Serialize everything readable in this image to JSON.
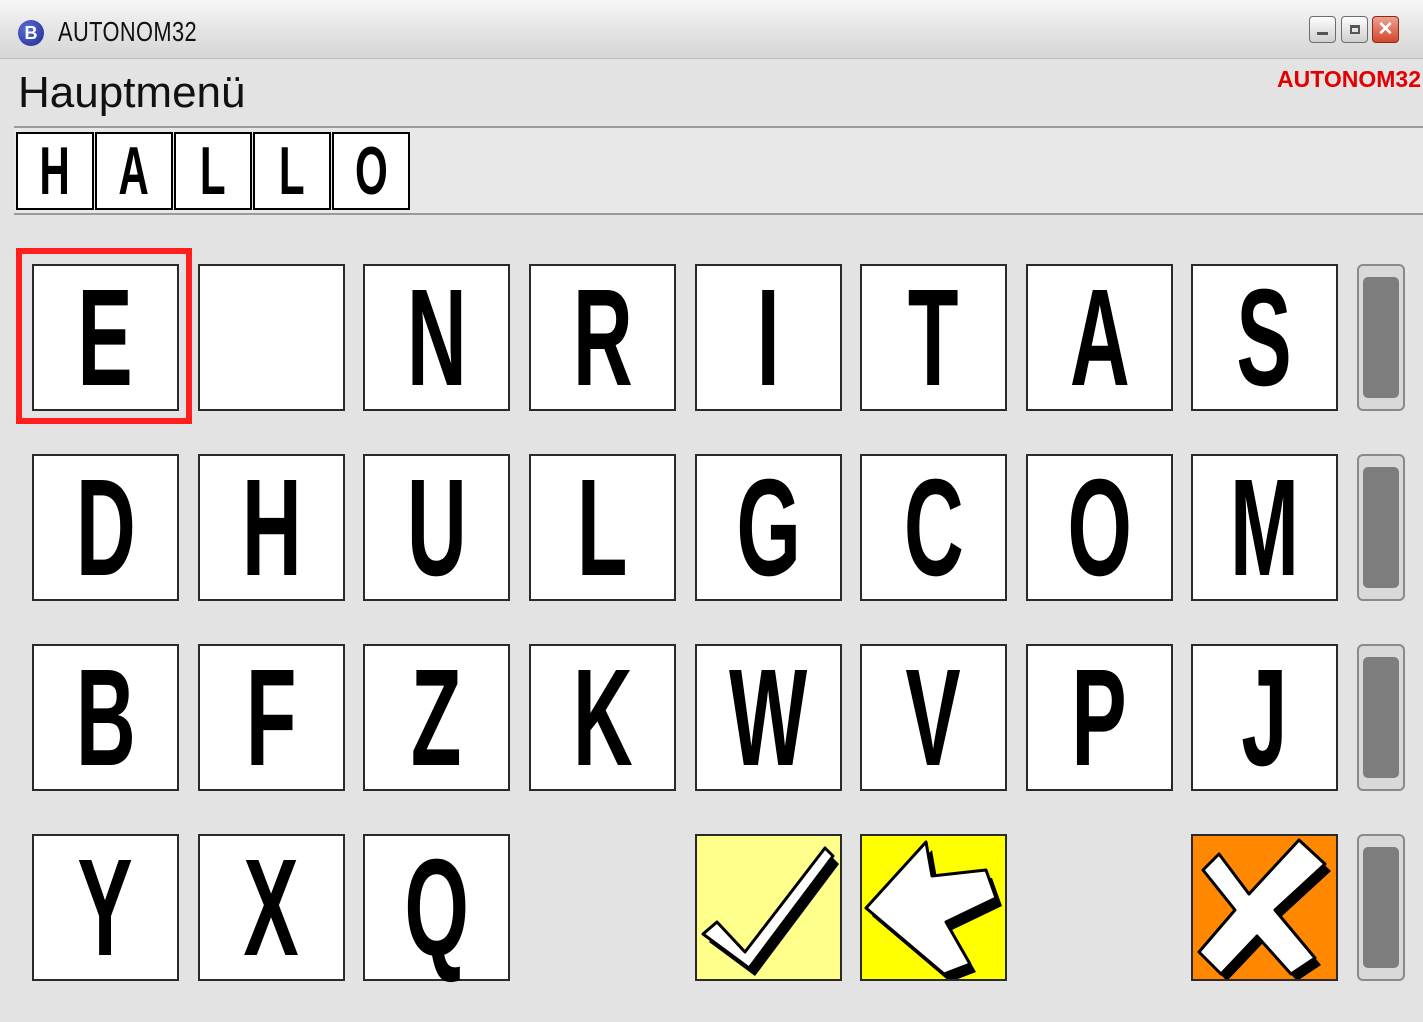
{
  "window": {
    "icon": "B",
    "title": "AUTONOM32",
    "minimize_icon": "minimize-icon",
    "maximize_icon": "maximize-icon",
    "close_icon": "close-icon"
  },
  "header": {
    "title": "Hauptmenü",
    "brand": "AUTONOM32"
  },
  "text_output": {
    "letters": [
      "H",
      "A",
      "L",
      "L",
      "O"
    ]
  },
  "keyboard": {
    "selected_key": "E",
    "rows": [
      [
        "E",
        "",
        "N",
        "R",
        "I",
        "T",
        "A",
        "S"
      ],
      [
        "D",
        "H",
        "U",
        "L",
        "G",
        "C",
        "O",
        "M"
      ],
      [
        "B",
        "F",
        "Z",
        "K",
        "W",
        "V",
        "P",
        "J"
      ],
      [
        "Y",
        "X",
        "Q"
      ]
    ],
    "actions": {
      "confirm_icon": "checkmark-icon",
      "backspace_icon": "back-arrow-icon",
      "cancel_icon": "cross-icon"
    }
  },
  "colors": {
    "selection": "#ff1f1f",
    "brand": "#e30000",
    "confirm_bg": "#ffff8c",
    "backspace_bg": "#ffff00",
    "cancel_bg": "#ff8800"
  }
}
